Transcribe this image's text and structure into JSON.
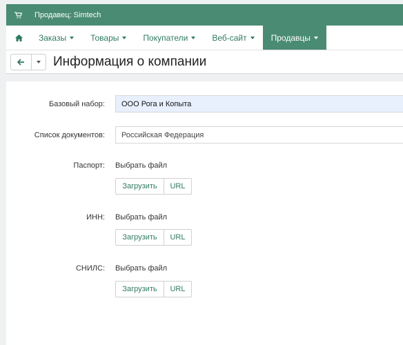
{
  "topbar": {
    "vendor_text": "Продавец: Simtech",
    "icon": "cart-icon"
  },
  "nav": {
    "home_icon": "home-icon",
    "items": [
      {
        "label": "Заказы",
        "active": false
      },
      {
        "label": "Товары",
        "active": false
      },
      {
        "label": "Покупатели",
        "active": false
      },
      {
        "label": "Веб-сайт",
        "active": false
      },
      {
        "label": "Продавцы",
        "active": true
      }
    ]
  },
  "header": {
    "title": "Информация о компании",
    "back_icon": "arrow-left-icon"
  },
  "form": {
    "base_set_label": "Базовый набор:",
    "base_set_value": "ООО Рога и Копыта",
    "docs_label": "Список документов:",
    "docs_value": "Российская Федерация",
    "passport_label": "Паспорт:",
    "inn_label": "ИНН:",
    "snils_label": "СНИЛС:",
    "choose_file": "Выбрать файл",
    "upload_label": "Загрузить",
    "url_label": "URL"
  },
  "colors": {
    "brand": "#4a8b73",
    "link": "#2f7a61"
  }
}
